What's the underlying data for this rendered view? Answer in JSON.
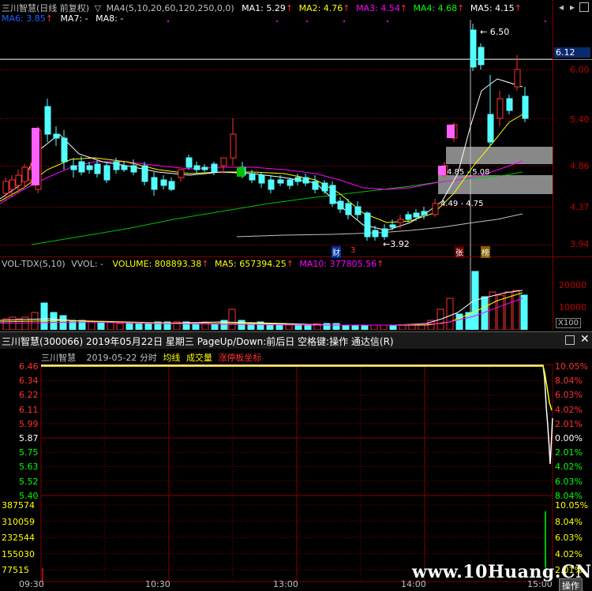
{
  "kline": {
    "title": "三川智慧(日线 前复权)",
    "indicator": "MA4(5,10,20,60,120,250,0,0)",
    "ma": [
      {
        "label": "MA1: 5.29",
        "color": "#ffffff"
      },
      {
        "label": "MA2: 4.76",
        "color": "#ffff00"
      },
      {
        "label": "MA3: 4.54",
        "color": "#ff00ff"
      },
      {
        "label": "MA4: 4.68",
        "color": "#00ff00"
      },
      {
        "label": "MA5: 4.15",
        "color": "#ffffff"
      },
      {
        "label": "MA6: 3.85",
        "color": "#2060ff"
      },
      {
        "label": "MA7: -",
        "color": "#ffffff"
      },
      {
        "label": "MA8: -",
        "color": "#ffffff"
      }
    ],
    "price_axis": [
      "6.00",
      "5.40",
      "4.86",
      "4.37",
      "3.94"
    ],
    "current_price": "6.12",
    "annotations": {
      "high": "6.50",
      "low": "3.92",
      "zone1": "4.85 - 5.08",
      "zone2": "4.49 - 4.75"
    },
    "badges": {
      "cai": "财",
      "gu": "3",
      "zhang": "张",
      "bang": "榜"
    }
  },
  "volume": {
    "title": "VOL-TDX(5,10)",
    "vvol": "VVOL: -",
    "volume": "VOLUME: 808893.38",
    "ma5": "MA5: 657394.25",
    "ma10": "MA10: 377805.56",
    "axis": [
      "20000",
      "10000"
    ],
    "unit": "X100"
  },
  "intraday_window": {
    "title": "三川智慧(300066) 2019年05月22日 星期三 PageUp/Down:前后日 空格键:操作 通达信(R)",
    "header": {
      "name": "三川智慧",
      "date": "2019-05-22 分时",
      "avg": "均线",
      "vol": "成交量",
      "limit": "涨停板坐标"
    },
    "left_prices": [
      "6.46",
      "6.34",
      "6.22",
      "6.11",
      "5.99",
      "5.87",
      "5.75",
      "5.63",
      "5.52",
      "5.40"
    ],
    "right_pcts": [
      "10.05%",
      "8.04%",
      "6.03%",
      "4.02%",
      "2.01%",
      "0.00%",
      "2.01%",
      "4.02%",
      "6.03%",
      "8.04%"
    ],
    "vol_left": [
      "387574",
      "310059",
      "232544",
      "155030",
      "77515"
    ],
    "vol_right": [
      "10.05%",
      "8.04%",
      "6.03%",
      "4.02%",
      "2.01%"
    ],
    "times": [
      "09:30",
      "10:30",
      "13:00",
      "14:00",
      "15:00"
    ],
    "operate": "操作",
    "watermark": "www.10Huang.CN"
  }
}
